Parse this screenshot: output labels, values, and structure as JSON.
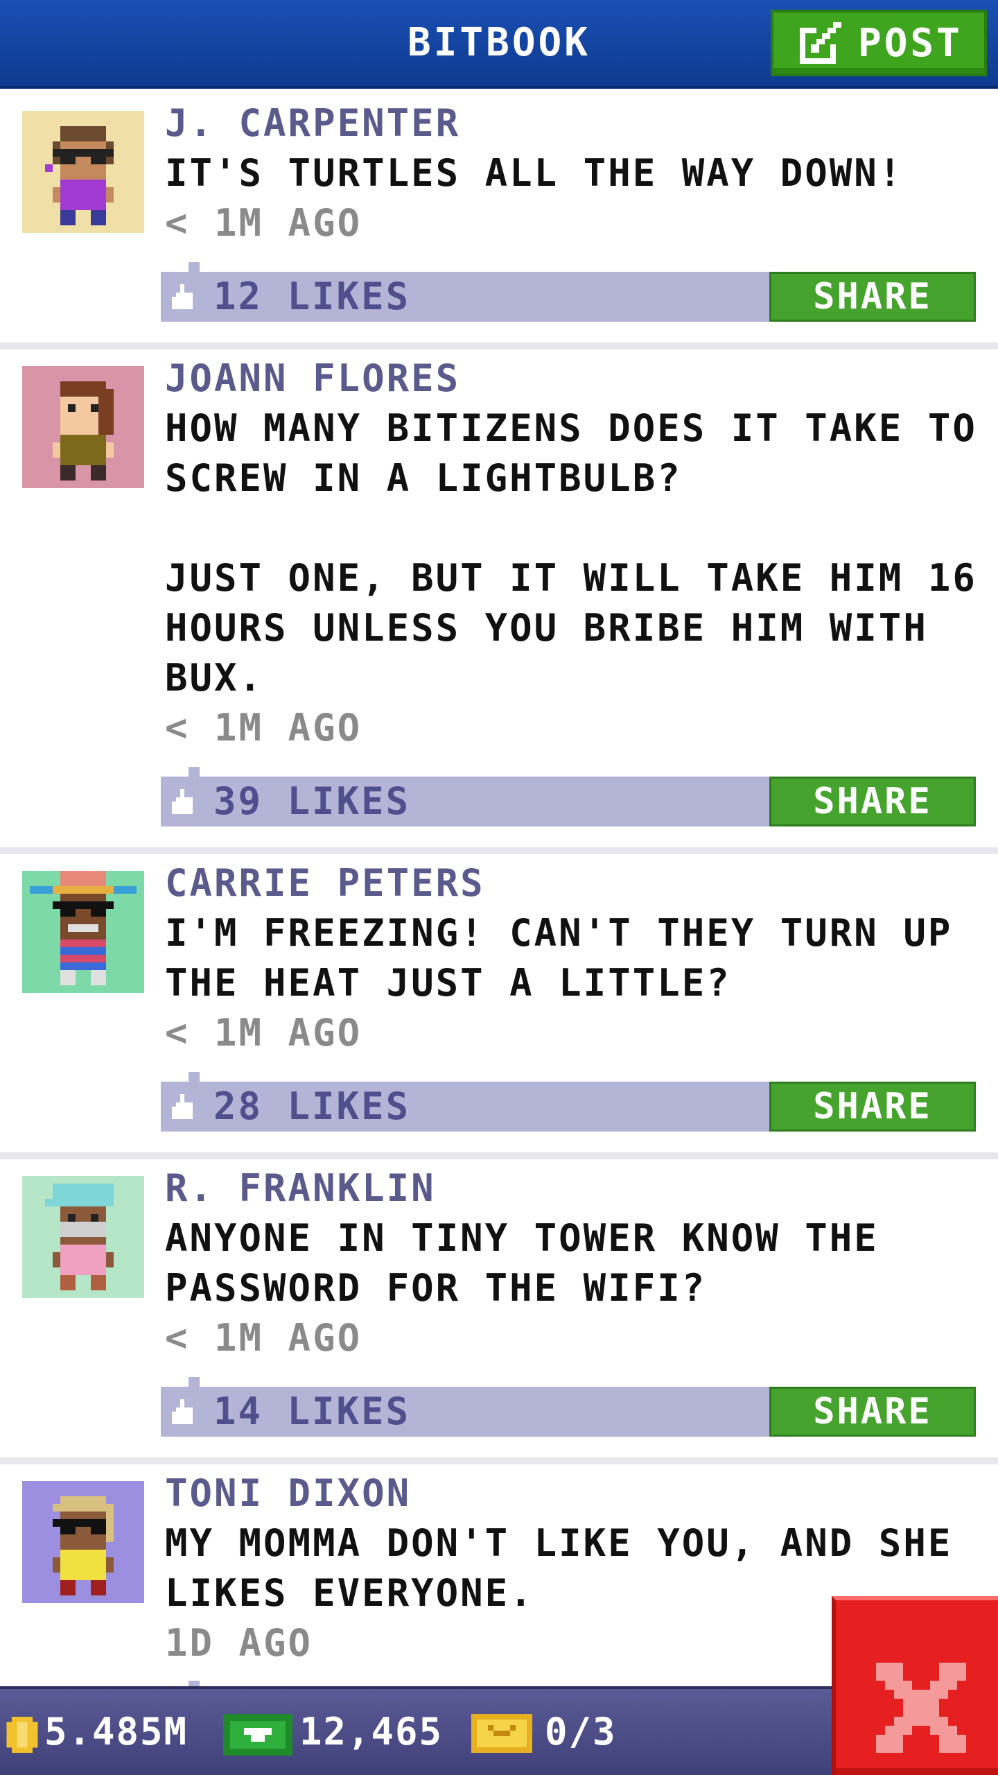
{
  "header": {
    "title": "BITBOOK",
    "post_label": "POST",
    "post_icon": "edit-icon"
  },
  "posts": [
    {
      "author": "J. CARPENTER",
      "message": "IT'S TURTLES ALL THE WAY DOWN!",
      "time": "< 1M AGO",
      "likes": "12 LIKES",
      "share_label": "SHARE",
      "avatar_bg": "#f0e0a8"
    },
    {
      "author": "JOANN FLORES",
      "message": "HOW MANY BITIZENS DOES IT TAKE TO SCREW IN A LIGHTBULB?\n\nJUST ONE, BUT IT WILL TAKE HIM 16 HOURS UNLESS YOU BRIBE HIM WITH BUX.",
      "time": "< 1M AGO",
      "likes": "39 LIKES",
      "share_label": "SHARE",
      "avatar_bg": "#d995a8"
    },
    {
      "author": "CARRIE PETERS",
      "message": "I'M FREEZING! CAN'T THEY TURN UP THE HEAT JUST A LITTLE?",
      "time": "< 1M AGO",
      "likes": "28 LIKES",
      "share_label": "SHARE",
      "avatar_bg": "#7ed9a8"
    },
    {
      "author": "R. FRANKLIN",
      "message": "ANYONE IN TINY TOWER KNOW THE PASSWORD FOR THE WIFI?",
      "time": "< 1M AGO",
      "likes": "14 LIKES",
      "share_label": "SHARE",
      "avatar_bg": "#b6e6c8"
    },
    {
      "author": "TONI DIXON",
      "message": "MY MOMMA DON'T LIKE YOU, AND SHE LIKES EVERYONE.",
      "time": "1D AGO",
      "avatar_bg": "#9d8fe0"
    }
  ],
  "status_bar": {
    "coins": "5.485M",
    "bux": "12,465",
    "vip": "0/3",
    "coin_icon": "coin-icon",
    "bux_icon": "bux-icon",
    "vip_icon": "vip-ticket-icon"
  },
  "close_icon": "close-icon",
  "colors": {
    "header": "#1a4fb3",
    "post_button": "#3fa51f",
    "author": "#5a5a8c",
    "like_bar": "#b3b4d6",
    "share_button": "#45a32e",
    "close_button": "#e62020",
    "status_bar": "#4a4a86"
  }
}
